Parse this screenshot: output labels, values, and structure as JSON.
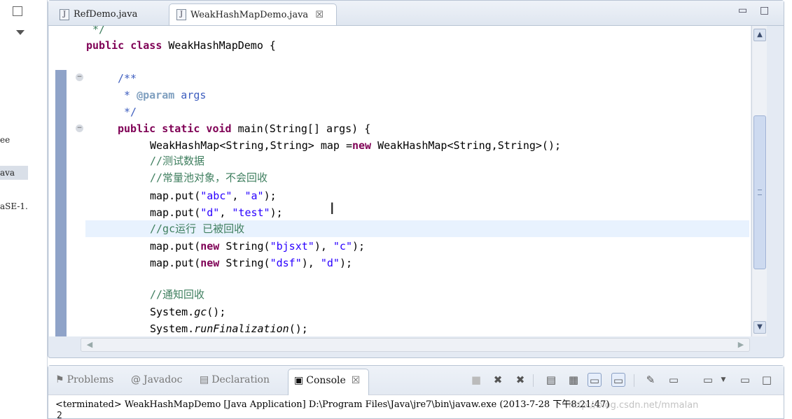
{
  "left_panel": {
    "items": [
      "ee",
      "ava",
      "aSE-1."
    ]
  },
  "editor": {
    "tabs": [
      {
        "label": "RefDemo.java",
        "active": false
      },
      {
        "label": "WeakHashMapDemo.java",
        "active": true
      }
    ],
    "close_glyph": "☒",
    "code": {
      "l0": "*/",
      "l1_kw": "public class",
      "l1_rest": " WeakHashMapDemo {",
      "l2": "/**",
      "l3_a": " * ",
      "l3_tag": "@param",
      "l3_b": " args",
      "l4": " */",
      "l5_kw": "public static void",
      "l5_rest": " main(String[] args) {",
      "l6_a": "WeakHashMap<String,String> map =",
      "l6_kw": "new",
      "l6_b": " WeakHashMap<String,String>();",
      "l7": "//测试数据",
      "l8": "//常量池对象，不会回收",
      "l9_a": "map.put(",
      "l9_s1": "\"abc\"",
      "l9_b": ", ",
      "l9_s2": "\"a\"",
      "l9_c": ");",
      "l10_a": "map.put(",
      "l10_s1": "\"d\"",
      "l10_b": ", ",
      "l10_s2": "\"test\"",
      "l10_c": ");",
      "l11": "//gc运行 已被回收",
      "l12_a": "map.put(",
      "l12_kw": "new",
      "l12_b": " String(",
      "l12_s1": "\"bjsxt\"",
      "l12_c": "), ",
      "l12_s2": "\"c\"",
      "l12_d": ");",
      "l13_a": "map.put(",
      "l13_kw": "new",
      "l13_b": " String(",
      "l13_s1": "\"dsf\"",
      "l13_c": "), ",
      "l13_s2": "\"d\"",
      "l13_d": ");",
      "l14": "//通知回收",
      "l15_a": "System.",
      "l15_it": "gc",
      "l15_b": "();",
      "l16_a": "System.",
      "l16_it": "runFinalization",
      "l16_b": "();"
    }
  },
  "console": {
    "tabs": [
      {
        "label": "Problems",
        "icon": "problems-icon"
      },
      {
        "label": "Javadoc",
        "icon": "javadoc-icon"
      },
      {
        "label": "Declaration",
        "icon": "declaration-icon"
      },
      {
        "label": "Console",
        "icon": "console-icon",
        "active": true
      }
    ],
    "status": "<terminated> WeakHashMapDemo [Java Application] D:\\Program Files\\Java\\jre7\\bin\\javaw.exe (2013-7-28 下午8:21:47)",
    "output_first_line": "2"
  },
  "watermark": "http://blog.csdn.net/mmalan"
}
